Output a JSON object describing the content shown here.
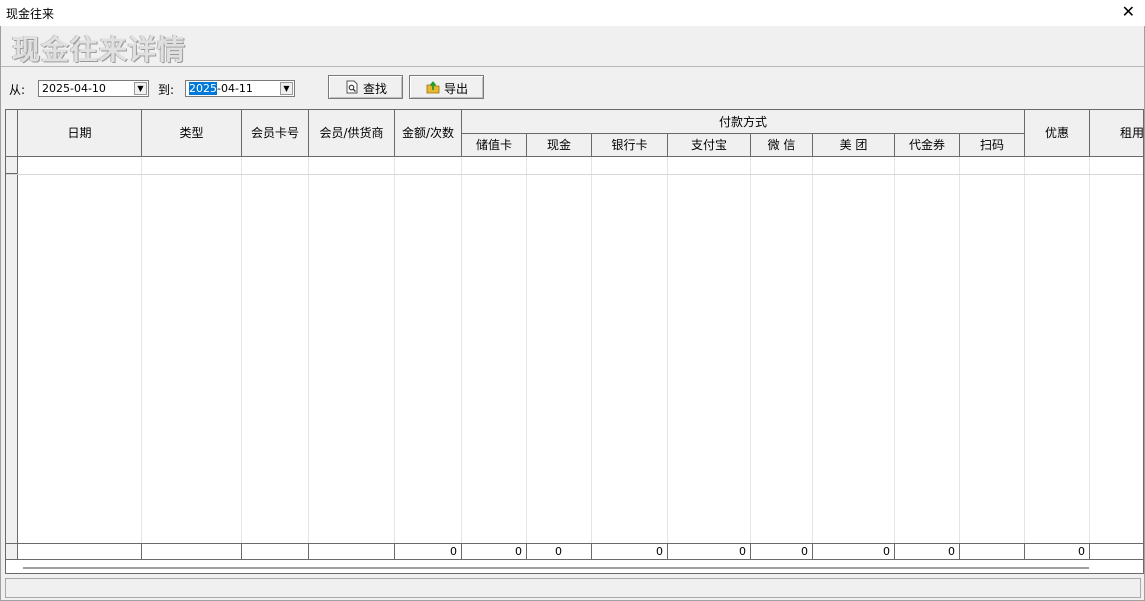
{
  "window": {
    "title": "现金往来",
    "close_glyph": "✕"
  },
  "banner_title": "现金往来详情",
  "filters": {
    "from_label": "从:",
    "from_value": "2025-04-10",
    "to_label": "到:",
    "to_value_selected": "2025",
    "to_value_rest": "-04-11"
  },
  "toolbar": {
    "search_label": "查找",
    "search_icon": "search-document-icon",
    "export_label": "导出",
    "export_icon": "export-folder-icon"
  },
  "table": {
    "payment_group": "付款方式",
    "columns": {
      "date": "日期",
      "type": "类型",
      "card": "会员卡号",
      "member": "会员/供货商",
      "amount": "金额/次数",
      "stored": "储值卡",
      "cash": "现金",
      "bank": "银行卡",
      "alipay": "支付宝",
      "wechat": "微 信",
      "meituan": "美 团",
      "voucher": "代金券",
      "scan": "扫码",
      "discount": "优惠",
      "rent": "租用"
    },
    "totals": {
      "amount": "0",
      "stored": "0",
      "cash": "0",
      "bank": "0",
      "alipay": "0",
      "wechat": "0",
      "meituan": "0",
      "voucher": "0",
      "discount": "0"
    }
  }
}
